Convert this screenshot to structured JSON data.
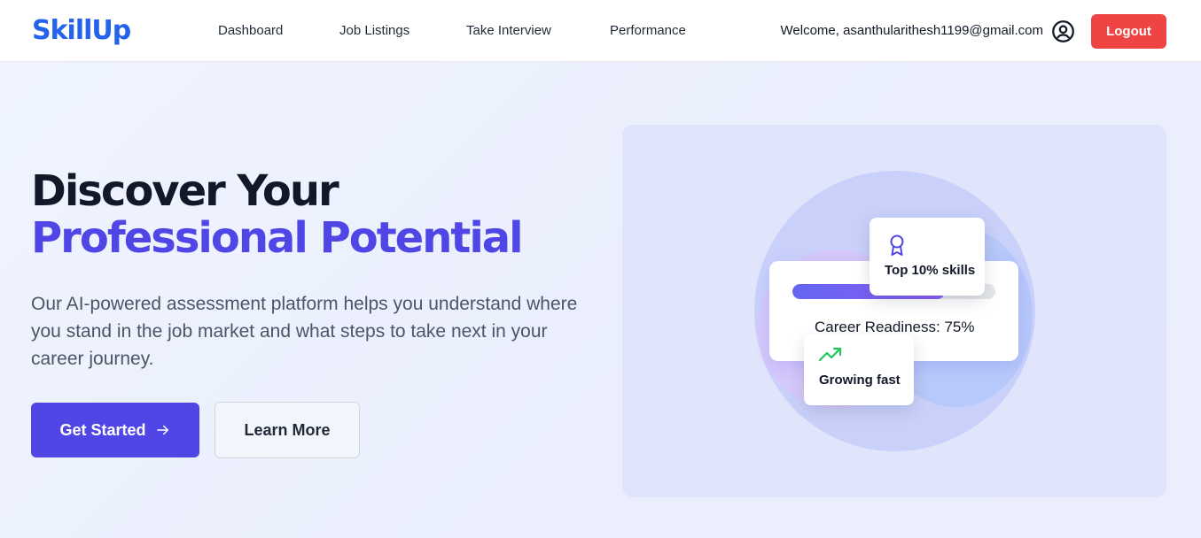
{
  "header": {
    "logo": "SkillUp",
    "nav": [
      {
        "label": "Dashboard"
      },
      {
        "label": "Job Listings"
      },
      {
        "label": "Take Interview"
      },
      {
        "label": "Performance"
      }
    ],
    "welcome": "Welcome, asanthularithesh1199@gmail.com",
    "user_icon": "user-circle-icon",
    "logout_label": "Logout"
  },
  "hero": {
    "headline_line1": "Discover Your",
    "headline_line2": "Professional Potential",
    "description": "Our AI-powered assessment platform helps you understand where you stand in the job market and what steps to take next in your career journey.",
    "primary_button": "Get Started",
    "primary_button_icon": "arrow-right-icon",
    "secondary_button": "Learn More"
  },
  "illustration": {
    "readiness_label": "Career Readiness: 75%",
    "readiness_progress": 0.75,
    "badge_top": {
      "label": "Top 10% skills",
      "icon": "award-icon"
    },
    "badge_bottom": {
      "label": "Growing fast",
      "icon": "trending-up-icon"
    }
  },
  "colors": {
    "brand": "#2563eb",
    "accent": "#4f46e5",
    "logout": "#ef4444",
    "trend": "#22c55e"
  }
}
